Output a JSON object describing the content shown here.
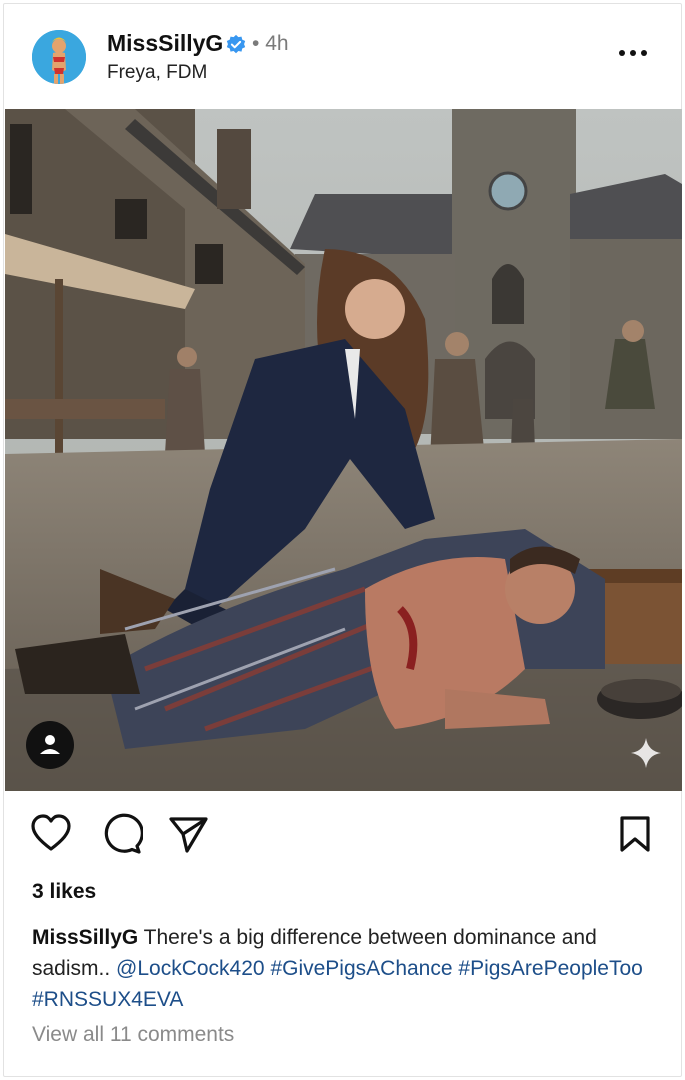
{
  "post": {
    "username": "MissSillyG",
    "separator": "•",
    "time": "4h",
    "location": "Freya, FDM",
    "verified": true
  },
  "icons": {
    "avatar": "profile-avatar",
    "verified": "verified-badge-icon",
    "more": "more-options-icon",
    "user_tag": "tagged-user-icon",
    "sparkle": "ai-sparkle-icon",
    "like": "heart-icon",
    "comment": "comment-icon",
    "share": "send-icon",
    "save": "bookmark-icon"
  },
  "colors": {
    "verified_badge": "#3897f0",
    "hashtag": "#1d4e89",
    "muted": "#8a8a8a"
  },
  "engagement": {
    "likes": "3 likes"
  },
  "caption": {
    "username": "MissSillyG",
    "text": " There's a big difference between dominance and sadism.. ",
    "mention": "@LockCock420",
    "tag1": "#GivePigsAChance",
    "tag2": "#PigsArePeopleToo",
    "tag3": "#RNSSUX4EVA"
  },
  "comments": {
    "view_all": "View all 11 comments"
  }
}
